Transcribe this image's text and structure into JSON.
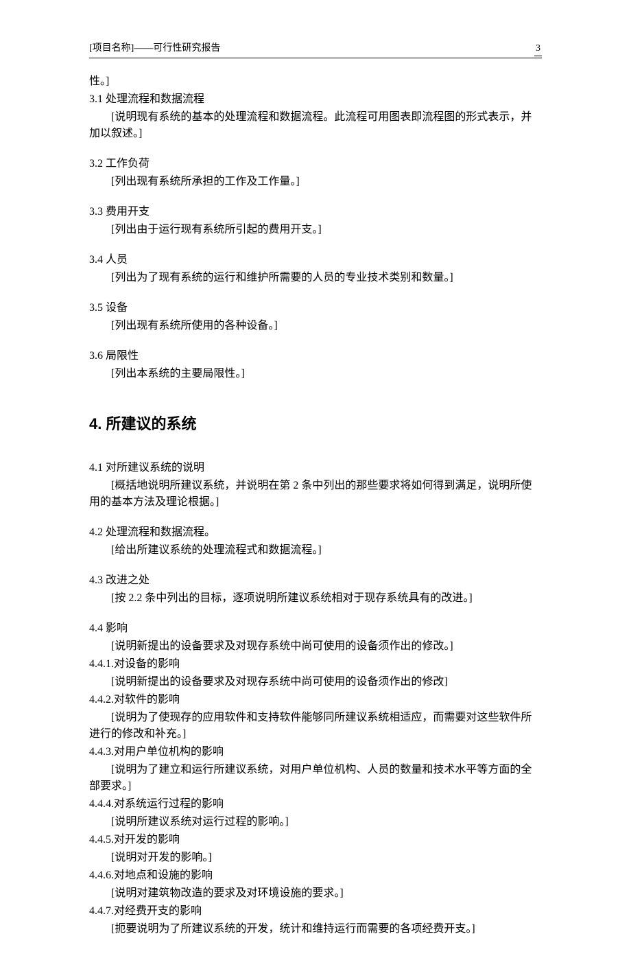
{
  "header": {
    "left": "[项目名称]——可行性研究报告",
    "pageNum": "3"
  },
  "frag_end": "性。]",
  "s31": {
    "title": "3.1 处理流程和数据流程",
    "body": "[说明现有系统的基本的处理流程和数据流程。此流程可用图表即流程图的形式表示，并加以叙述。]"
  },
  "s32": {
    "title": "3.2 工作负荷",
    "body": "[列出现有系统所承担的工作及工作量。]"
  },
  "s33": {
    "title": "3.3 费用开支",
    "body": "[列出由于运行现有系统所引起的费用开支。]"
  },
  "s34": {
    "title": "3.4 人员",
    "body": "[列出为了现有系统的运行和维护所需要的人员的专业技术类别和数量。]"
  },
  "s35": {
    "title": "3.5 设备",
    "body": "[列出现有系统所使用的各种设备。]"
  },
  "s36": {
    "title": "3.6 局限性",
    "body": "[列出本系统的主要局限性。]"
  },
  "h4": "4. 所建议的系统",
  "s41": {
    "title": "4.1 对所建议系统的说明",
    "body": "[概括地说明所建议系统，并说明在第 2 条中列出的那些要求将如何得到满足，说明所使用的基本方法及理论根据。]"
  },
  "s42": {
    "title": "4.2 处理流程和数据流程。",
    "body": "[给出所建议系统的处理流程式和数据流程。]"
  },
  "s43": {
    "title": "4.3 改进之处",
    "body": "[按 2.2 条中列出的目标，逐项说明所建议系统相对于现存系统具有的改进。]"
  },
  "s44": {
    "title": "4.4 影响",
    "body": "[说明新提出的设备要求及对现存系统中尚可使用的设备须作出的修改。]"
  },
  "s441": {
    "title": "4.4.1.对设备的影响",
    "body": "[说明新提出的设备要求及对现存系统中尚可使用的设备须作出的修改]"
  },
  "s442": {
    "title": "4.4.2.对软件的影响",
    "body": "[说明为了使现存的应用软件和支持软件能够同所建议系统相适应，而需要对这些软件所进行的修改和补充。]"
  },
  "s443": {
    "title": "4.4.3.对用户单位机构的影响",
    "body": "[说明为了建立和运行所建议系统，对用户单位机构、人员的数量和技术水平等方面的全部要求。]"
  },
  "s444": {
    "title": "4.4.4.对系统运行过程的影响",
    "body": "[说明所建议系统对运行过程的影响。]"
  },
  "s445": {
    "title": "4.4.5.对开发的影响",
    "body": "[说明对开发的影响。]"
  },
  "s446": {
    "title": "4.4.6.对地点和设施的影响",
    "body": "[说明对建筑物改造的要求及对环境设施的要求。]"
  },
  "s447": {
    "title": "4.4.7.对经费开支的影响",
    "body": "[扼要说明为了所建议系统的开发，统计和维持运行而需要的各项经费开支。]"
  }
}
